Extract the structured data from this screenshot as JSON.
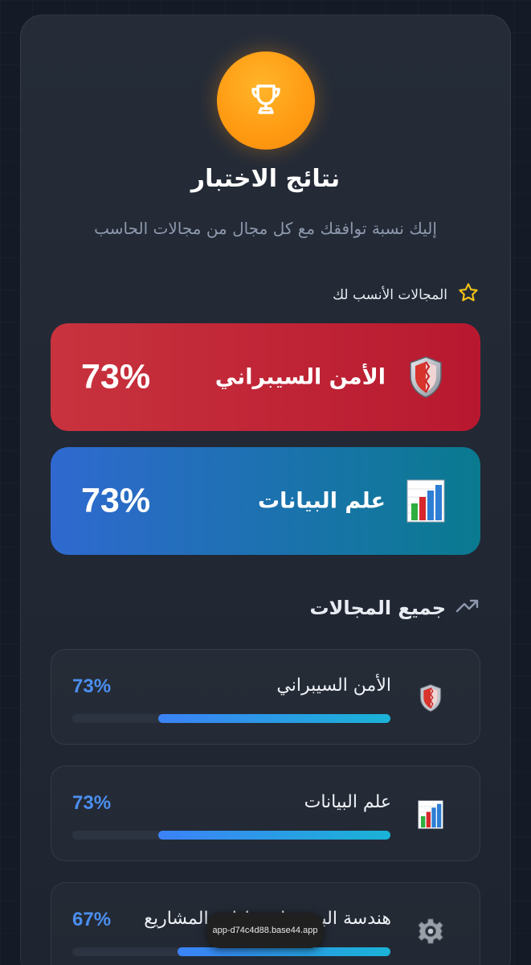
{
  "header": {
    "title": "نتائج الاختبار",
    "subtitle": "إليك نسبة توافقك مع كل مجال من مجالات الحاسب",
    "icon": "trophy-icon"
  },
  "top_section": {
    "heading": "المجالات الأنسب لك",
    "icon": "star-icon",
    "cards": [
      {
        "label": "الأمن السيبراني",
        "percent": "73%",
        "icon": "shield-icon",
        "color": "#c8333e"
      },
      {
        "label": "علم البيانات",
        "percent": "73%",
        "icon": "bar-chart-icon",
        "color": "#2f69d0"
      }
    ]
  },
  "all_section": {
    "heading": "جميع المجالات",
    "icon": "trending-up-icon",
    "rows": [
      {
        "label": "الأمن السيبراني",
        "percent": "73%",
        "value": 0.73,
        "icon": "shield-icon"
      },
      {
        "label": "علم البيانات",
        "percent": "73%",
        "value": 0.73,
        "icon": "bar-chart-icon"
      },
      {
        "label": "هندسة البرمجيات وإدارة المشاريع",
        "percent": "67%",
        "value": 0.67,
        "icon": "gear-icon"
      }
    ]
  },
  "toast": {
    "text": "app-d74c4d88.base44.app"
  },
  "colors": {
    "accent_blue": "#4b8ff0",
    "trophy_orange": "#ff9a12",
    "star_yellow": "#f5c518"
  }
}
